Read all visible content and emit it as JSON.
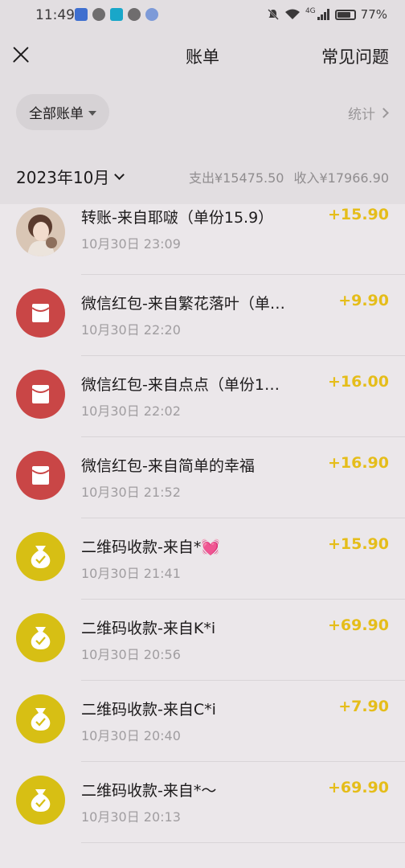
{
  "status_bar": {
    "time": "11:49",
    "signal": "4G",
    "battery": "77%"
  },
  "header": {
    "title": "账单",
    "faq_label": "常见问题"
  },
  "filter": {
    "label": "全部账单",
    "stats_label": "统计"
  },
  "month_bar": {
    "month": "2023年10月",
    "expense": "支出¥15475.50",
    "income": "收入¥17966.90"
  },
  "colors": {
    "amount": "#e5bd1a",
    "red_packet": "#c94646",
    "qr_coin": "#d7bf14"
  },
  "transactions": [
    {
      "icon": "user-photo",
      "desc": "转账-来自耶啵（单份15.9）",
      "time": "10月30日 23:09",
      "amount": "+15.90"
    },
    {
      "icon": "red-packet-icon",
      "desc": "微信红包-来自繁花落叶（单…",
      "time": "10月30日 22:20",
      "amount": "+9.90"
    },
    {
      "icon": "red-packet-icon",
      "desc": "微信红包-来自点点（单份1…",
      "time": "10月30日 22:02",
      "amount": "+16.00"
    },
    {
      "icon": "red-packet-icon",
      "desc": "微信红包-来自简单的幸福",
      "time": "10月30日 21:52",
      "amount": "+16.90"
    },
    {
      "icon": "money-bag-icon",
      "desc": "二维码收款-来自*💓",
      "time": "10月30日 21:41",
      "amount": "+15.90"
    },
    {
      "icon": "money-bag-icon",
      "desc": "二维码收款-来自K*i",
      "time": "10月30日 20:56",
      "amount": "+69.90"
    },
    {
      "icon": "money-bag-icon",
      "desc": "二维码收款-来自C*i",
      "time": "10月30日 20:40",
      "amount": "+7.90"
    },
    {
      "icon": "money-bag-icon",
      "desc": "二维码收款-来自*～",
      "time": "10月30日 20:13",
      "amount": "+69.90"
    }
  ]
}
